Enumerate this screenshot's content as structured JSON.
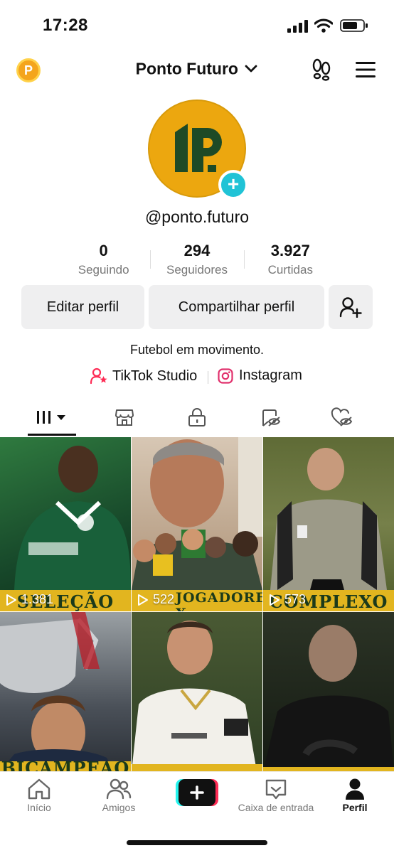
{
  "status_bar": {
    "time": "17:28"
  },
  "header": {
    "coin_letter": "P",
    "account_name": "Ponto Futuro"
  },
  "profile": {
    "handle": "@ponto.futuro",
    "bio": "Futebol em movimento.",
    "stats": [
      {
        "value": "0",
        "label": "Seguindo"
      },
      {
        "value": "294",
        "label": "Seguidores"
      },
      {
        "value": "3.927",
        "label": "Curtidas"
      }
    ],
    "buttons": {
      "edit": "Editar perfil",
      "share": "Compartilhar perfil"
    },
    "links": [
      {
        "label": "TikTok Studio",
        "icon": "tiktok-studio-icon"
      },
      {
        "label": "Instagram",
        "icon": "instagram-icon"
      }
    ]
  },
  "tabs": [
    {
      "name": "videos",
      "icon": "grid-icon",
      "active": true
    },
    {
      "name": "shop",
      "icon": "shop-icon"
    },
    {
      "name": "private",
      "icon": "lock-icon"
    },
    {
      "name": "reposts",
      "icon": "hidden-repost-icon"
    },
    {
      "name": "liked",
      "icon": "hidden-heart-icon"
    }
  ],
  "videos": [
    {
      "views": "1.381",
      "banner": "SELEÇÃO",
      "bg": "#1f5a34"
    },
    {
      "views": "522",
      "banner": "JOGADORES X",
      "bg": "#bfa48c"
    },
    {
      "views": "573",
      "banner": "COMPLEXO",
      "bg": "#6e7a3a"
    },
    {
      "views": "",
      "banner": "BICAMPEÃO",
      "bg": "#3c4046"
    },
    {
      "views": "",
      "banner": "",
      "bg": "#2e3f24"
    },
    {
      "views": "",
      "banner": "",
      "bg": "#1c2418"
    }
  ],
  "nav": [
    {
      "label": "Início",
      "icon": "home-icon"
    },
    {
      "label": "Amigos",
      "icon": "friends-icon"
    },
    {
      "label": "",
      "icon": "create-icon"
    },
    {
      "label": "Caixa de entrada",
      "icon": "inbox-icon"
    },
    {
      "label": "Perfil",
      "icon": "profile-icon",
      "active": true
    }
  ],
  "colors": {
    "accent_cyan": "#20c3d6",
    "accent_pink": "#fe2c55",
    "brand_yellow": "#eca70f",
    "brand_green": "#1e4a26"
  }
}
